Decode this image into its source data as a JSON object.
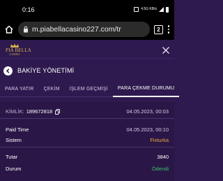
{
  "status": {
    "time": "0:16",
    "net": "4.5G\nKB/s"
  },
  "browser": {
    "url": "m.piabellacasino227.com/tr",
    "tabs_count": "2"
  },
  "brand": {
    "logo_text": "PIA BELLA",
    "logo_sub": "CASINO",
    "gold_color": "#d9b24c"
  },
  "section": {
    "title": "BAKİYE YÖNETİMİ"
  },
  "tabs": [
    {
      "label": "PARA YATIR"
    },
    {
      "label": "ÇEKİM"
    },
    {
      "label": "İŞLEM GEÇMİŞİ"
    },
    {
      "label": "PARA ÇEKME DURUMU"
    }
  ],
  "transaction": {
    "id_label": "KİMLİK:",
    "id_value": "189672818",
    "date": "04.05.2023, 00:03",
    "paid_time_label": "Paid Time",
    "paid_time_value": "04.05.2023, 00:10",
    "system_label": "Sistem",
    "system_value": "Fixturka",
    "amount_label": "Tutar",
    "amount_value": "3840",
    "status_label": "Durum",
    "status_value": "Ödendi"
  },
  "colors": {
    "background": "#2e1a4f",
    "system_value": "#f0a53a",
    "status_paid": "#39c16b"
  }
}
